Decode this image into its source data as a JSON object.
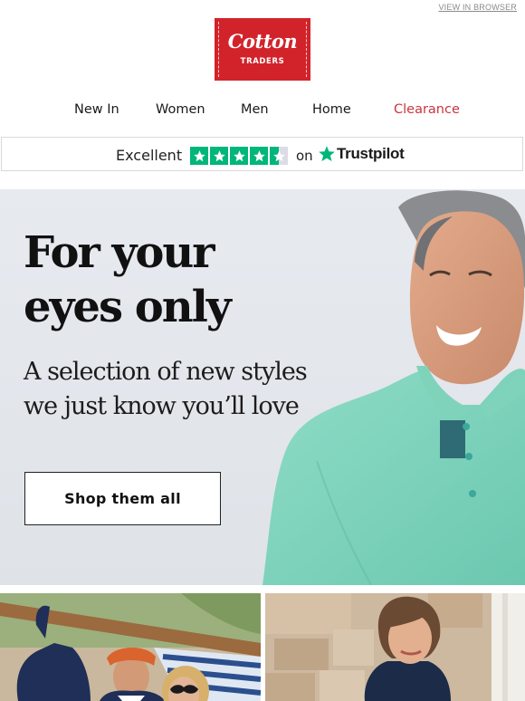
{
  "header": {
    "view_in_browser": "VIEW IN BROWSER",
    "logo": {
      "brand": "Cotton",
      "sub": "TRADERS",
      "color": "#d2232a"
    }
  },
  "nav": {
    "items": [
      {
        "label": "New In"
      },
      {
        "label": "Women"
      },
      {
        "label": "Men"
      },
      {
        "label": "Home"
      },
      {
        "label": "Clearance",
        "color": "#c8363d"
      }
    ]
  },
  "trustpilot": {
    "rating_word": "Excellent",
    "stars": 4.5,
    "star_color": "#00b67a",
    "connector": "on",
    "brand": "Trustpilot"
  },
  "hero": {
    "title_line1": "For your",
    "title_line2": "eyes only",
    "subtitle_line1": "A selection of new styles",
    "subtitle_line2": "we just know you’ll love",
    "cta_label": "Shop them all",
    "image": "smiling-man-mint-polo-photo"
  },
  "tiles": [
    {
      "image": "couple-on-boat-photo"
    },
    {
      "image": "woman-stone-wall-photo"
    }
  ]
}
